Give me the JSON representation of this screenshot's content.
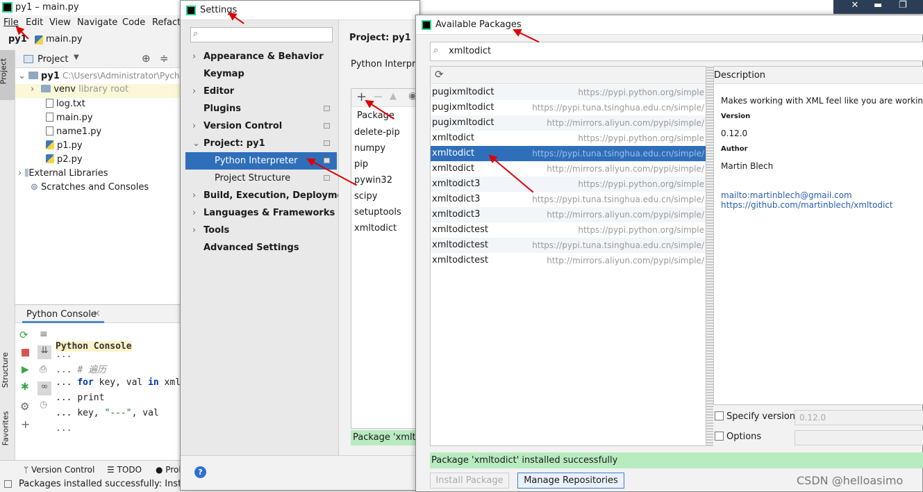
{
  "ide": {
    "title": "py1 – main.py",
    "menu": [
      "File",
      "Edit",
      "View",
      "Navigate",
      "Code",
      "Refacto"
    ],
    "breadcrumb_project": "py1",
    "breadcrumb_file": "main.py",
    "side_tabs": {
      "project": "Project",
      "structure": "Structure",
      "favorites": "Favorites"
    },
    "project_panel": {
      "header": "Project",
      "root_name": "py1",
      "root_path": "C:\\Users\\Administrator\\Pycha",
      "venv": "venv",
      "venv_hint": "library root",
      "files": [
        "log.txt",
        "main.py",
        "name1.py",
        "p1.py",
        "p2.py"
      ],
      "external": "External Libraries",
      "scratches": "Scratches and Consoles"
    },
    "console": {
      "tab": "Python Console",
      "title_line": "Python Console",
      "lines": [
        "...",
        "... # 遍历",
        "... for key, val in xml",
        "...     print",
        "...     key, \"---\", val",
        "..."
      ],
      "line_for_kw": "for",
      "line_for_rest": " key, val ",
      "line_in_kw": "in",
      "line_for_tail": " xml",
      "line_comment": "# 遍历",
      "line_print": "print",
      "line_key": "key, ",
      "line_str": "\"---\"",
      "line_val": ", val"
    },
    "statusbar": {
      "tabs": [
        "Version Control",
        "TODO",
        "Prol"
      ],
      "message": "Packages installed successfully: Installed"
    }
  },
  "settings": {
    "title": "Settings",
    "search_placeholder": "",
    "items": [
      {
        "label": "Appearance & Behavior",
        "chev": "›",
        "mark": false
      },
      {
        "label": "Keymap",
        "chev": "",
        "mark": false
      },
      {
        "label": "Editor",
        "chev": "›",
        "mark": false
      },
      {
        "label": "Plugins",
        "chev": "",
        "mark": true
      },
      {
        "label": "Version Control",
        "chev": "›",
        "mark": true
      },
      {
        "label": "Project: py1",
        "chev": "⌄",
        "mark": true
      },
      {
        "label": "Python Interpreter",
        "chev": "",
        "mark": true
      },
      {
        "label": "Project Structure",
        "chev": "",
        "mark": true
      },
      {
        "label": "Build, Execution, Deployment",
        "chev": "›",
        "mark": false
      },
      {
        "label": "Languages & Frameworks",
        "chev": "›",
        "mark": false
      },
      {
        "label": "Tools",
        "chev": "›",
        "mark": false
      },
      {
        "label": "Advanced Settings",
        "chev": "",
        "mark": false
      }
    ],
    "main_heading": "Project: py1",
    "main_sep": "›",
    "interpreter_label": "Python Interpret",
    "package_col": "Package",
    "packages": [
      "delete-pip",
      "numpy",
      "pip",
      "pywin32",
      "scipy",
      "setuptools",
      "xmltodict"
    ],
    "install_msg": "Package 'xmltod",
    "help": "?"
  },
  "available": {
    "title": "Available Packages",
    "search_value": "xmltodict",
    "rows": [
      {
        "name": "pugixmltodict",
        "repo": "https://pypi.python.org/simple"
      },
      {
        "name": "pugixmltodict",
        "repo": "https://pypi.tuna.tsinghua.edu.cn/simple/"
      },
      {
        "name": "pugixmltodict",
        "repo": "http://mirrors.aliyun.com/pypi/simple/"
      },
      {
        "name": "xmltodict",
        "repo": "https://pypi.python.org/simple"
      },
      {
        "name": "xmltodict",
        "repo": "https://pypi.tuna.tsinghua.edu.cn/simple/"
      },
      {
        "name": "xmltodict",
        "repo": "http://mirrors.aliyun.com/pypi/simple/"
      },
      {
        "name": "xmltodict3",
        "repo": "https://pypi.python.org/simple"
      },
      {
        "name": "xmltodict3",
        "repo": "https://pypi.tuna.tsinghua.edu.cn/simple/"
      },
      {
        "name": "xmltodict3",
        "repo": "http://mirrors.aliyun.com/pypi/simple/"
      },
      {
        "name": "xmltodictest",
        "repo": "https://pypi.python.org/simple"
      },
      {
        "name": "xmltodictest",
        "repo": "https://pypi.tuna.tsinghua.edu.cn/simple/"
      },
      {
        "name": "xmltodictest",
        "repo": "http://mirrors.aliyun.com/pypi/simple/"
      }
    ],
    "selected_index": 4,
    "description": {
      "heading": "Description",
      "summary": "Makes working with XML feel like you are working with",
      "version_label": "Version",
      "version": "0.12.0",
      "author_label": "Author",
      "author": "Martin Blech",
      "email": "mailto:martinblech@gmail.com",
      "url": "https://github.com/martinblech/xmltodict"
    },
    "specify_version_label": "Specify version",
    "specify_version_value": "0.12.0",
    "options_label": "Options",
    "status": "Package 'xmltodict' installed successfully",
    "install_button": "Install Package",
    "manage_button": "Manage Repositories"
  },
  "watermark": "CSDN @helloasimo",
  "colors": {
    "selection": "#2f6fba",
    "success": "#b9ebc0",
    "arrow": "#e00000",
    "link": "#2a5db0"
  }
}
